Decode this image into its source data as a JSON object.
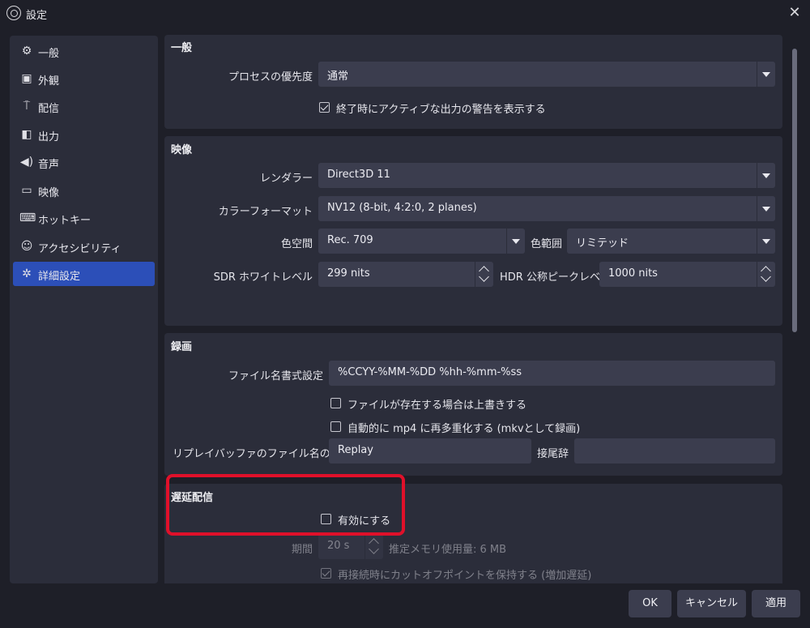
{
  "window": {
    "title": "設定"
  },
  "sidebar": {
    "items": [
      {
        "label": "一般",
        "icon": "gear-icon"
      },
      {
        "label": "外観",
        "icon": "appearance-icon"
      },
      {
        "label": "配信",
        "icon": "broadcast-icon"
      },
      {
        "label": "出力",
        "icon": "output-icon"
      },
      {
        "label": "音声",
        "icon": "speaker-icon"
      },
      {
        "label": "映像",
        "icon": "monitor-icon"
      },
      {
        "label": "ホットキー",
        "icon": "keyboard-icon"
      },
      {
        "label": "アクセシビリティ",
        "icon": "accessibility-icon"
      },
      {
        "label": "詳細設定",
        "icon": "tools-icon"
      }
    ],
    "active_index": 8
  },
  "general": {
    "title": "一般",
    "priority_label": "プロセスの優先度",
    "priority_value": "通常",
    "warn_label": "終了時にアクティブな出力の警告を表示する",
    "warn_checked": true
  },
  "video": {
    "title": "映像",
    "renderer_label": "レンダラー",
    "renderer_value": "Direct3D 11",
    "color_format_label": "カラーフォーマット",
    "color_format_value": "NV12 (8-bit, 4:2:0, 2 planes)",
    "color_space_label": "色空間",
    "color_space_value": "Rec. 709",
    "color_range_label": "色範囲",
    "color_range_value": "リミテッド",
    "sdr_label": "SDR ホワイトレベル",
    "sdr_value": "299 nits",
    "hdr_label": "HDR 公称ピークレベル",
    "hdr_value": "1000 nits"
  },
  "recording": {
    "title": "録画",
    "filename_label": "ファイル名書式設定",
    "filename_value": "%CCYY-%MM-%DD %hh-%mm-%ss",
    "overwrite_label": "ファイルが存在する場合は上書きする",
    "overwrite_checked": false,
    "remux_label": "自動的に mp4 に再多重化する (mkvとして録画)",
    "remux_checked": false,
    "replay_prefix_label": "リプレイバッファのファイル名の接頭辞",
    "replay_prefix_value": "Replay",
    "suffix_label": "接尾辞",
    "suffix_value": ""
  },
  "delay": {
    "title": "遅延配信",
    "enable_label": "有効にする",
    "enable_checked": false,
    "duration_label": "期間",
    "duration_value": "20 s",
    "memory_label": "推定メモリ使用量: 6 MB",
    "preserve_label": "再接続時にカットオフポイントを保持する (増加遅延)",
    "preserve_checked": true
  },
  "buttons": {
    "ok": "OK",
    "cancel": "キャンセル",
    "apply": "適用"
  },
  "colors": {
    "accent": "#2c4fb8",
    "highlight": "#e0102a",
    "panel": "#2b2d3a",
    "field": "#3b3d4e"
  }
}
